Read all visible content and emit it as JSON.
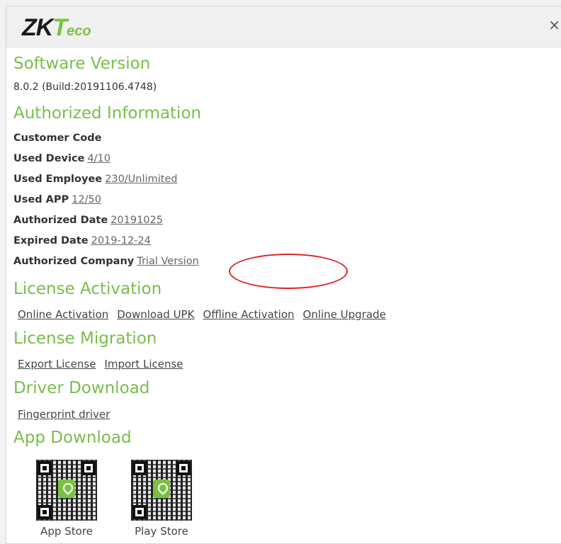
{
  "header": {
    "logo_main": "ZK",
    "logo_t": "T",
    "logo_eco": "eco",
    "close_glyph": "×"
  },
  "software": {
    "title": "Software Version",
    "version": "8.0.2 (Build:20191106.4748)"
  },
  "authorized": {
    "title": "Authorized Information",
    "rows": [
      {
        "label": "Customer Code",
        "value": ""
      },
      {
        "label": "Used Device",
        "value": "4/10"
      },
      {
        "label": "Used Employee",
        "value": "230/Unlimited"
      },
      {
        "label": "Used APP",
        "value": "12/50"
      },
      {
        "label": "Authorized Date",
        "value": "20191025"
      },
      {
        "label": "Expired Date",
        "value": "2019-12-24"
      },
      {
        "label": "Authorized Company",
        "value": "Trial Version"
      }
    ]
  },
  "license_activation": {
    "title": "License Activation",
    "links": [
      "Online Activation",
      "Download UPK",
      "Offline Activation",
      "Online Upgrade"
    ]
  },
  "license_migration": {
    "title": "License Migration",
    "links": [
      "Export License",
      "Import License"
    ]
  },
  "driver_download": {
    "title": "Driver Download",
    "links": [
      "Fingerprint driver"
    ]
  },
  "app_download": {
    "title": "App Download",
    "apps": [
      {
        "caption": "App Store",
        "icon": "qr-code-icon"
      },
      {
        "caption": "Play Store",
        "icon": "qr-code-icon"
      }
    ]
  },
  "colors": {
    "accent_green": "#79bd4b",
    "highlight_red": "#e02424"
  }
}
